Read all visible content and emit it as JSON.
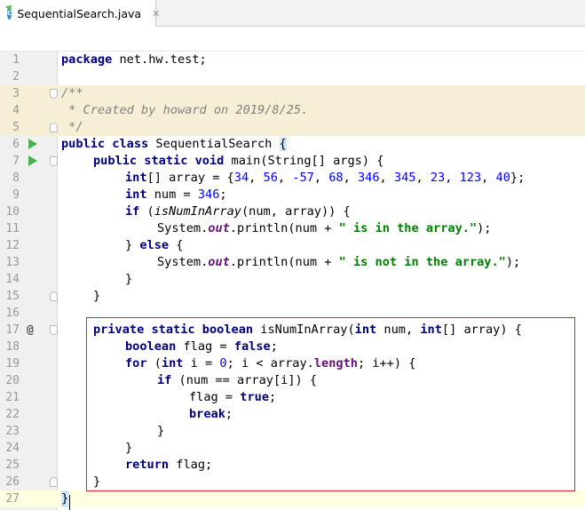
{
  "tab": {
    "filename": "SequentialSearch.java",
    "icon": "java-class-icon",
    "icon_letter": "c",
    "close_glyph": "✕"
  },
  "gutter_marker": "@",
  "code": {
    "l1": [
      "package",
      " net.hw.test;"
    ],
    "l3": "/**",
    "l4": " * Created by howard on 2019/8/25.",
    "l5": " */",
    "l6": [
      "public",
      " ",
      "class",
      " SequentialSearch ",
      "{"
    ],
    "l7": [
      "public",
      " ",
      "static",
      " ",
      "void",
      " main(String[] args) {"
    ],
    "l8": [
      "int",
      "[] array = {",
      "34",
      ", ",
      "56",
      ", ",
      "-57",
      ", ",
      "68",
      ", ",
      "346",
      ", ",
      "345",
      ", ",
      "23",
      ", ",
      "123",
      ", ",
      "40",
      "};"
    ],
    "l9": [
      "int",
      " num = ",
      "346",
      ";"
    ],
    "l10": [
      "if",
      " (",
      "isNumInArray",
      "(num, array)) {"
    ],
    "l11": [
      "System.",
      "out",
      ".println(num + ",
      "\" is in the array.\"",
      ");"
    ],
    "l12": [
      "} ",
      "else",
      " {"
    ],
    "l13": [
      "System.",
      "out",
      ".println(num + ",
      "\" is not in the array.\"",
      ");"
    ],
    "l14": "}",
    "l15": "}",
    "l17": [
      "private",
      " ",
      "static",
      " ",
      "boolean",
      " isNumInArray(",
      "int",
      " num, ",
      "int",
      "[] array) {"
    ],
    "l18": [
      "boolean",
      " flag = ",
      "false",
      ";"
    ],
    "l19": [
      "for",
      " (",
      "int",
      " i = ",
      "0",
      "; i < array.",
      "length",
      "; i++) {"
    ],
    "l20": [
      "if",
      " (num == array[i]) {"
    ],
    "l21": [
      "flag = ",
      "true",
      ";"
    ],
    "l22": [
      "break",
      ";"
    ],
    "l23": "}",
    "l24": "}",
    "l25": [
      "return",
      " flag;"
    ],
    "l26": "}",
    "l27": "}"
  },
  "line_numbers": [
    "1",
    "2",
    "3",
    "4",
    "5",
    "6",
    "7",
    "8",
    "9",
    "10",
    "11",
    "12",
    "13",
    "14",
    "15",
    "16",
    "17",
    "18",
    "19",
    "20",
    "21",
    "22",
    "23",
    "24",
    "25",
    "26",
    "27"
  ],
  "colors": {
    "keyword": "#000080",
    "number": "#0000ff",
    "string": "#008000",
    "comment": "#808080",
    "field": "#660e7a",
    "highlight_box": "#e02020"
  }
}
